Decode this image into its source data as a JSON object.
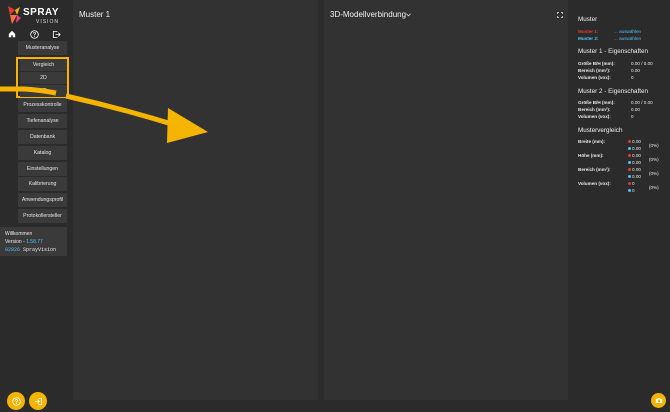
{
  "brand": {
    "name": "SPRAY",
    "subtitle": "VISION",
    "icons": [
      "home-icon",
      "help-circle-icon",
      "logout-icon"
    ]
  },
  "nav": {
    "musteranalyse": "Musteranalyse",
    "vergleich": "Vergleich",
    "sub2d": "2D",
    "sub3d": "3D",
    "prozesskontrolle": "Prozesskontrolle",
    "tiefenanalyse": "Tiefenanalyse",
    "datenbank": "Datenbank",
    "katalog": "Katalog",
    "einstellungen": "Einstellungen",
    "kalibrierung": "Kalibrierung",
    "anwendungsprofil": "Anwendungsprofil",
    "protokollersteller": "Protokollersteller"
  },
  "welcome": {
    "title": "Willkommen",
    "version_label": "Version - ",
    "version": "1.58.77",
    "code": "02826",
    "user": "SprayVision"
  },
  "panel1": {
    "title": "Muster 1"
  },
  "panel2": {
    "title": "3D-Modellverbindung",
    "dropdown_icon": "chevron-down-icon",
    "expand_icon": "fullscreen-icon"
  },
  "info": {
    "title": "Muster",
    "muster1_label": "Muster 1:",
    "muster2_label": "Muster 2:",
    "select_text": "... auswählen",
    "m1_props_title": "Muster 1 - Eigenschaften",
    "m2_props_title": "Muster 2 - Eigenschaften",
    "props": {
      "size_label": "Größe B/H (mm):",
      "size_val": "0.00 / 0.00",
      "area_label": "Bereich (mm²):",
      "area_val": "0.00",
      "volume_label": "Volumen (vox):",
      "volume_val": "0"
    },
    "compare_title": "Mustervergleich",
    "compare": {
      "breite_label": "Breite (mm):",
      "hoehe_label": "Höhe (mm):",
      "bereich_label": "Bereich (mm²):",
      "volumen_label": "Volumen (vox):",
      "dec_val": "0.00",
      "int_val": "0",
      "pct": "(0%)"
    },
    "colors": {
      "muster1": "#e53935",
      "muster2": "#4fc3f7"
    }
  },
  "accent_color": "#f5b400",
  "fabs": [
    "help-icon",
    "login-icon",
    "camera-icon"
  ]
}
